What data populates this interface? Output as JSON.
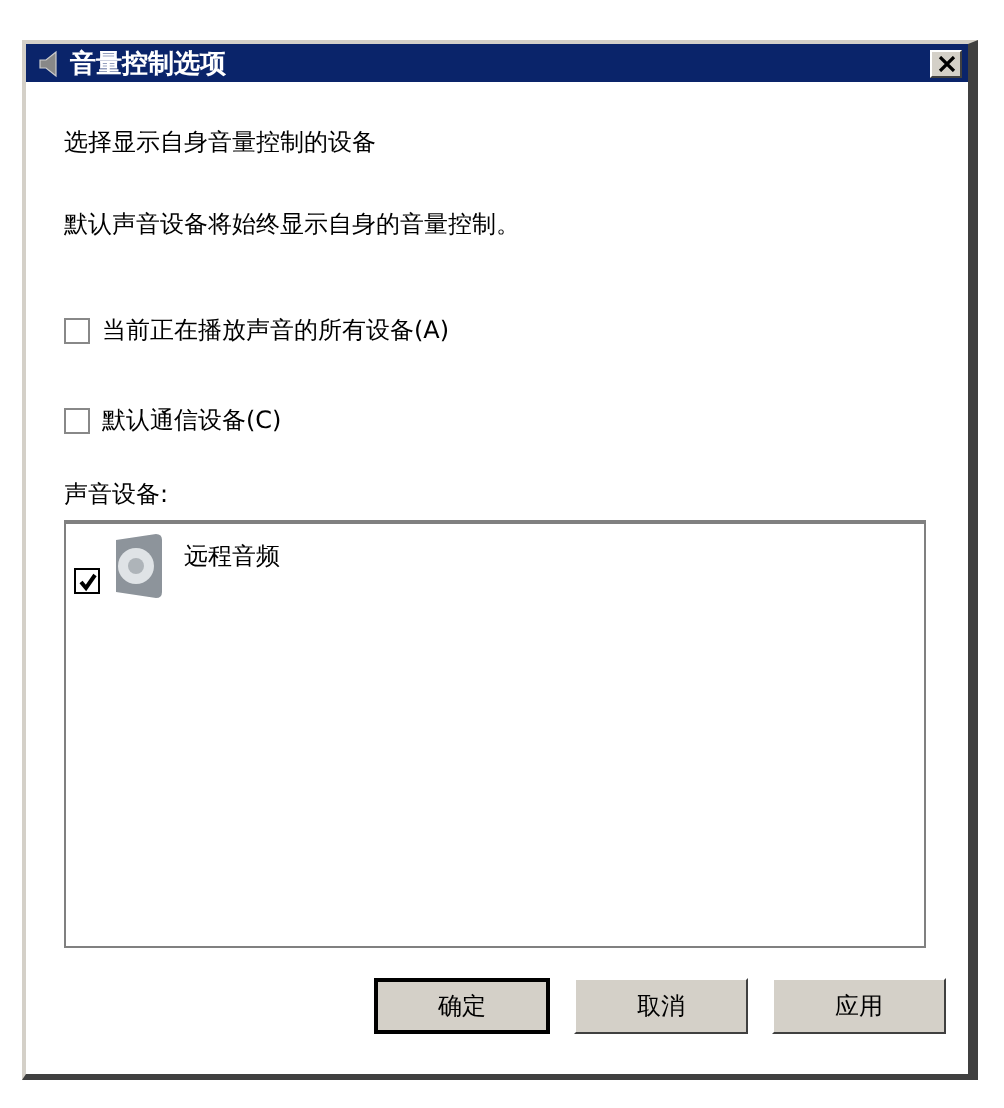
{
  "window": {
    "title": "音量控制选项"
  },
  "intro": "选择显示自身音量控制的设备",
  "note": "默认声音设备将始终显示自身的音量控制。",
  "options": [
    {
      "label": "当前正在播放声音的所有设备(A)",
      "checked": false
    },
    {
      "label": "默认通信设备(C)",
      "checked": false
    }
  ],
  "devices_label": "声音设备:",
  "devices": [
    {
      "name": "远程音频",
      "checked": true
    }
  ],
  "buttons": [
    {
      "label": "确定",
      "default": true
    },
    {
      "label": "取消",
      "default": false
    },
    {
      "label": "应用",
      "default": false
    }
  ]
}
